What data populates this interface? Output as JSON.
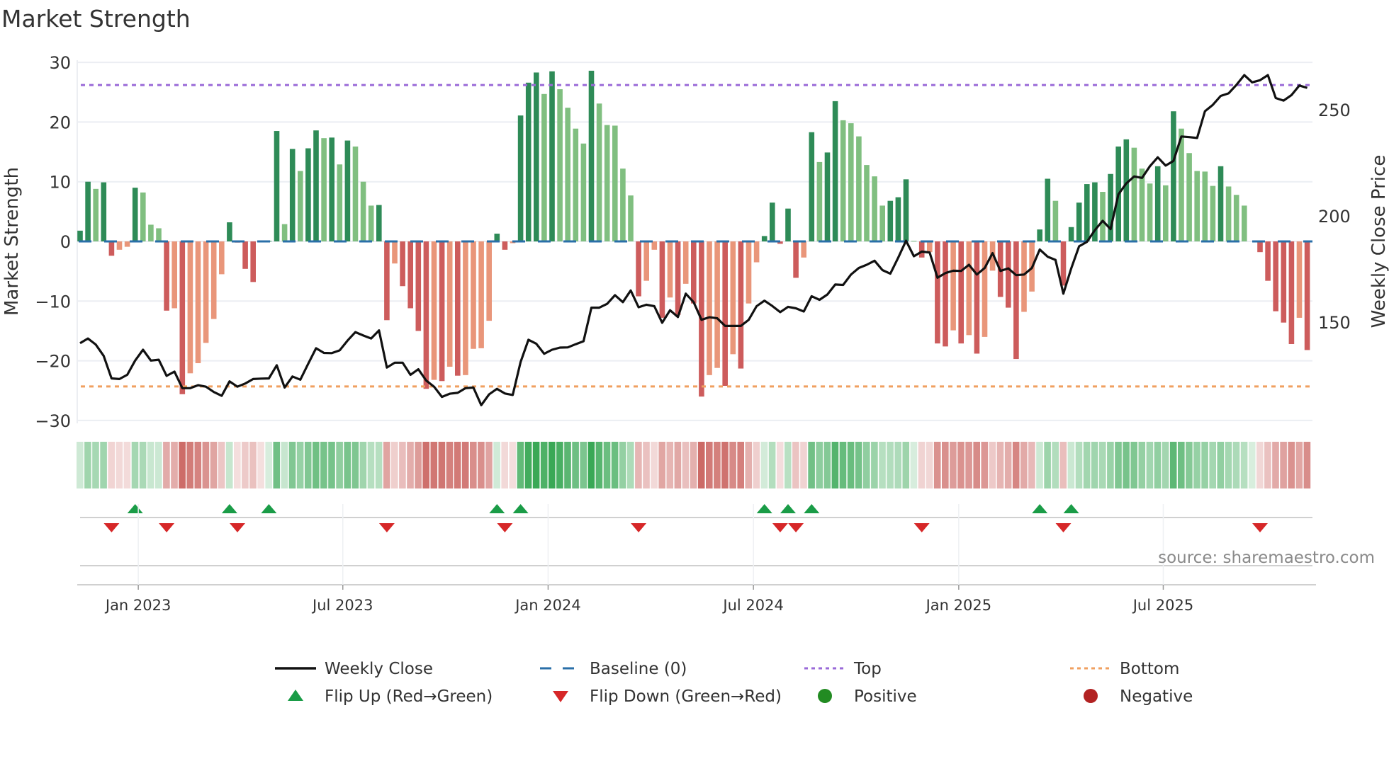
{
  "chart_data": {
    "type": "bar",
    "title": "Market Strength",
    "ylabel": "Market Strength",
    "y2label": "Weekly Close Price",
    "ylim": [
      -30,
      30
    ],
    "y2_ticks": [
      "250",
      "200",
      "150"
    ],
    "y2_tick_values": [
      250,
      200,
      150
    ],
    "y_ticks": [
      "30",
      "20",
      "10",
      "0",
      "−10",
      "−20",
      "−30"
    ],
    "y_tick_values": [
      30,
      20,
      10,
      0,
      -10,
      -20,
      -30
    ],
    "top_level": 26.2,
    "bottom_level": -24.3,
    "x_ticks": [
      {
        "label": "Jan 2023",
        "week_index": 7.4
      },
      {
        "label": "Jul 2023",
        "week_index": 33.4
      },
      {
        "label": "Jan 2024",
        "week_index": 59.5
      },
      {
        "label": "Jul 2024",
        "week_index": 85.6
      },
      {
        "label": "Jan 2025",
        "week_index": 111.7
      },
      {
        "label": "Jul 2025",
        "week_index": 137.7
      }
    ],
    "strength": [
      1.8,
      10,
      8.8,
      9.9,
      -2.4,
      -1.4,
      -0.9,
      9.0,
      8.2,
      2.8,
      2.2,
      -11.6,
      -11.2,
      -25.6,
      -22.1,
      -20.4,
      -17,
      -13,
      -5.5,
      3.2,
      -0.2,
      -4.6,
      -6.8,
      -0.1,
      0.1,
      18.5,
      2.9,
      15.5,
      11.8,
      15.6,
      18.6,
      17.3,
      17.4,
      12.9,
      16.9,
      15.9,
      10,
      6.0,
      6.1,
      -13.2,
      -3.7,
      -7.5,
      -11.2,
      -15,
      -24.7,
      -23.2,
      -23.4,
      -21,
      -22.5,
      -22.4,
      -18,
      -17.9,
      -13.3,
      1.3,
      -1.4,
      -0.3,
      21.1,
      26.6,
      28.3,
      24.7,
      28.5,
      25.5,
      22.4,
      18.9,
      16.4,
      28.6,
      23.1,
      19.5,
      19.4,
      12.2,
      7.7,
      -9.2,
      -6.6,
      -1.4,
      -12.8,
      -9.4,
      -12.3,
      -7.1,
      -10.4,
      -26,
      -22.4,
      -21.2,
      -24.2,
      -18.9,
      -21.3,
      -10.4,
      -3.5,
      0.9,
      6.5,
      -0.4,
      5.5,
      -6.1,
      -2.7,
      18.3,
      13.3,
      14.9,
      23.5,
      20.3,
      19.8,
      17.6,
      12.8,
      10.9,
      6,
      6.8,
      7.4,
      10.4,
      0.1,
      -2.7,
      -1.8,
      -17.1,
      -17.6,
      -14.9,
      -17.1,
      -15.7,
      -18.8,
      -16,
      -4.9,
      -9.3,
      -11.1,
      -19.7,
      -11.8,
      -8.4,
      2,
      10.5,
      6.8,
      -7.4,
      2.4,
      6.5,
      9.6,
      9.9,
      8.3,
      11.3,
      15.9,
      17.1,
      15.7,
      12.2,
      9.7,
      12.6,
      9.4,
      21.8,
      18.9,
      14.8,
      11.8,
      11.7,
      9.3,
      12.6,
      9.2,
      7.8,
      6,
      0,
      -1.8,
      -6.6,
      -11.7,
      -13.6,
      -17.2,
      -12.8,
      -18.2
    ],
    "weekly_close": [
      140.1,
      142.3,
      139.4,
      134.1,
      123.5,
      123.2,
      125.2,
      131.9,
      137,
      131.9,
      132.3,
      124.7,
      126.7,
      118.9,
      118.9,
      120.3,
      119.6,
      117.1,
      115.3,
      122.1,
      119.6,
      121.1,
      123.2,
      123.4,
      123.5,
      129.7,
      119.2,
      124.4,
      122.9,
      130.4,
      137.7,
      135.5,
      135.4,
      136.7,
      141.3,
      145.3,
      143.7,
      142.3,
      146.1,
      128.6,
      130.9,
      130.9,
      125.2,
      127.8,
      122.5,
      119.6,
      114.8,
      116.3,
      116.7,
      118.9,
      119.2,
      110.9,
      116,
      118.6,
      116.4,
      115.7,
      131.2,
      141.7,
      139.8,
      135.1,
      137,
      138,
      138.1,
      139.6,
      141,
      156.8,
      156.8,
      158.6,
      162.7,
      159.4,
      164.9,
      157,
      158.2,
      157.5,
      149.7,
      155.6,
      152.4,
      163.4,
      159.4,
      151.1,
      152.3,
      151.8,
      148.2,
      148.2,
      148.2,
      151.1,
      157.5,
      160.1,
      157.6,
      154.7,
      157.2,
      156.5,
      155,
      162.2,
      160.5,
      163,
      167.7,
      167.5,
      172.4,
      175.5,
      177,
      178.9,
      174.5,
      172.8,
      180.3,
      188.3,
      181,
      183.2,
      182.8,
      170.9,
      173.1,
      174.2,
      174.1,
      177,
      172.4,
      175.5,
      182.5,
      174.1,
      175.3,
      172.1,
      172.4,
      175.5,
      184.2,
      180.8,
      179.3,
      163.4,
      175.3,
      185.7,
      187.8,
      193.3,
      197.7,
      193.8,
      210.2,
      215.3,
      218.6,
      217.9,
      223.4,
      227.6,
      223.7,
      225.9,
      237.4,
      237.1,
      236.7,
      249.3,
      252.3,
      256.5,
      257.7,
      261.7,
      266.3,
      262.9,
      263.9,
      266.3,
      255.5,
      254.3,
      256.9,
      261.4,
      260.3
    ],
    "flip_up_weeks": [
      7,
      19,
      24,
      53,
      56,
      87,
      90,
      93,
      122,
      126
    ],
    "flip_down_weeks": [
      4,
      11,
      20,
      39,
      54,
      71,
      89,
      91,
      107,
      125,
      150
    ],
    "legend": {
      "position": "bottom",
      "entries": [
        {
          "label": "Weekly Close",
          "kind": "line",
          "color": "#111111"
        },
        {
          "label": "Baseline (0)",
          "kind": "dash",
          "color": "#2a6fa8"
        },
        {
          "label": "Top",
          "kind": "dot",
          "color": "#9a6ad8"
        },
        {
          "label": "Bottom",
          "kind": "dot",
          "color": "#f0a060"
        },
        {
          "label": "Flip Up (Red→Green)",
          "kind": "tri-up",
          "color": "#1a9c47"
        },
        {
          "label": "Flip Down (Green→Red)",
          "kind": "tri-down",
          "color": "#d62728"
        },
        {
          "label": "Positive",
          "kind": "circle",
          "color": "#228b22"
        },
        {
          "label": "Negative",
          "kind": "circle",
          "color": "#b22222"
        }
      ]
    },
    "colors": {
      "pos_up": "#2e8b57",
      "pos_down": "#80bf80",
      "neg_down": "#cd5c5c",
      "neg_up": "#e9967a",
      "heat_pos": "#3aa856",
      "heat_neg": "#c9605c"
    },
    "source": "source: sharemaestro.com"
  }
}
